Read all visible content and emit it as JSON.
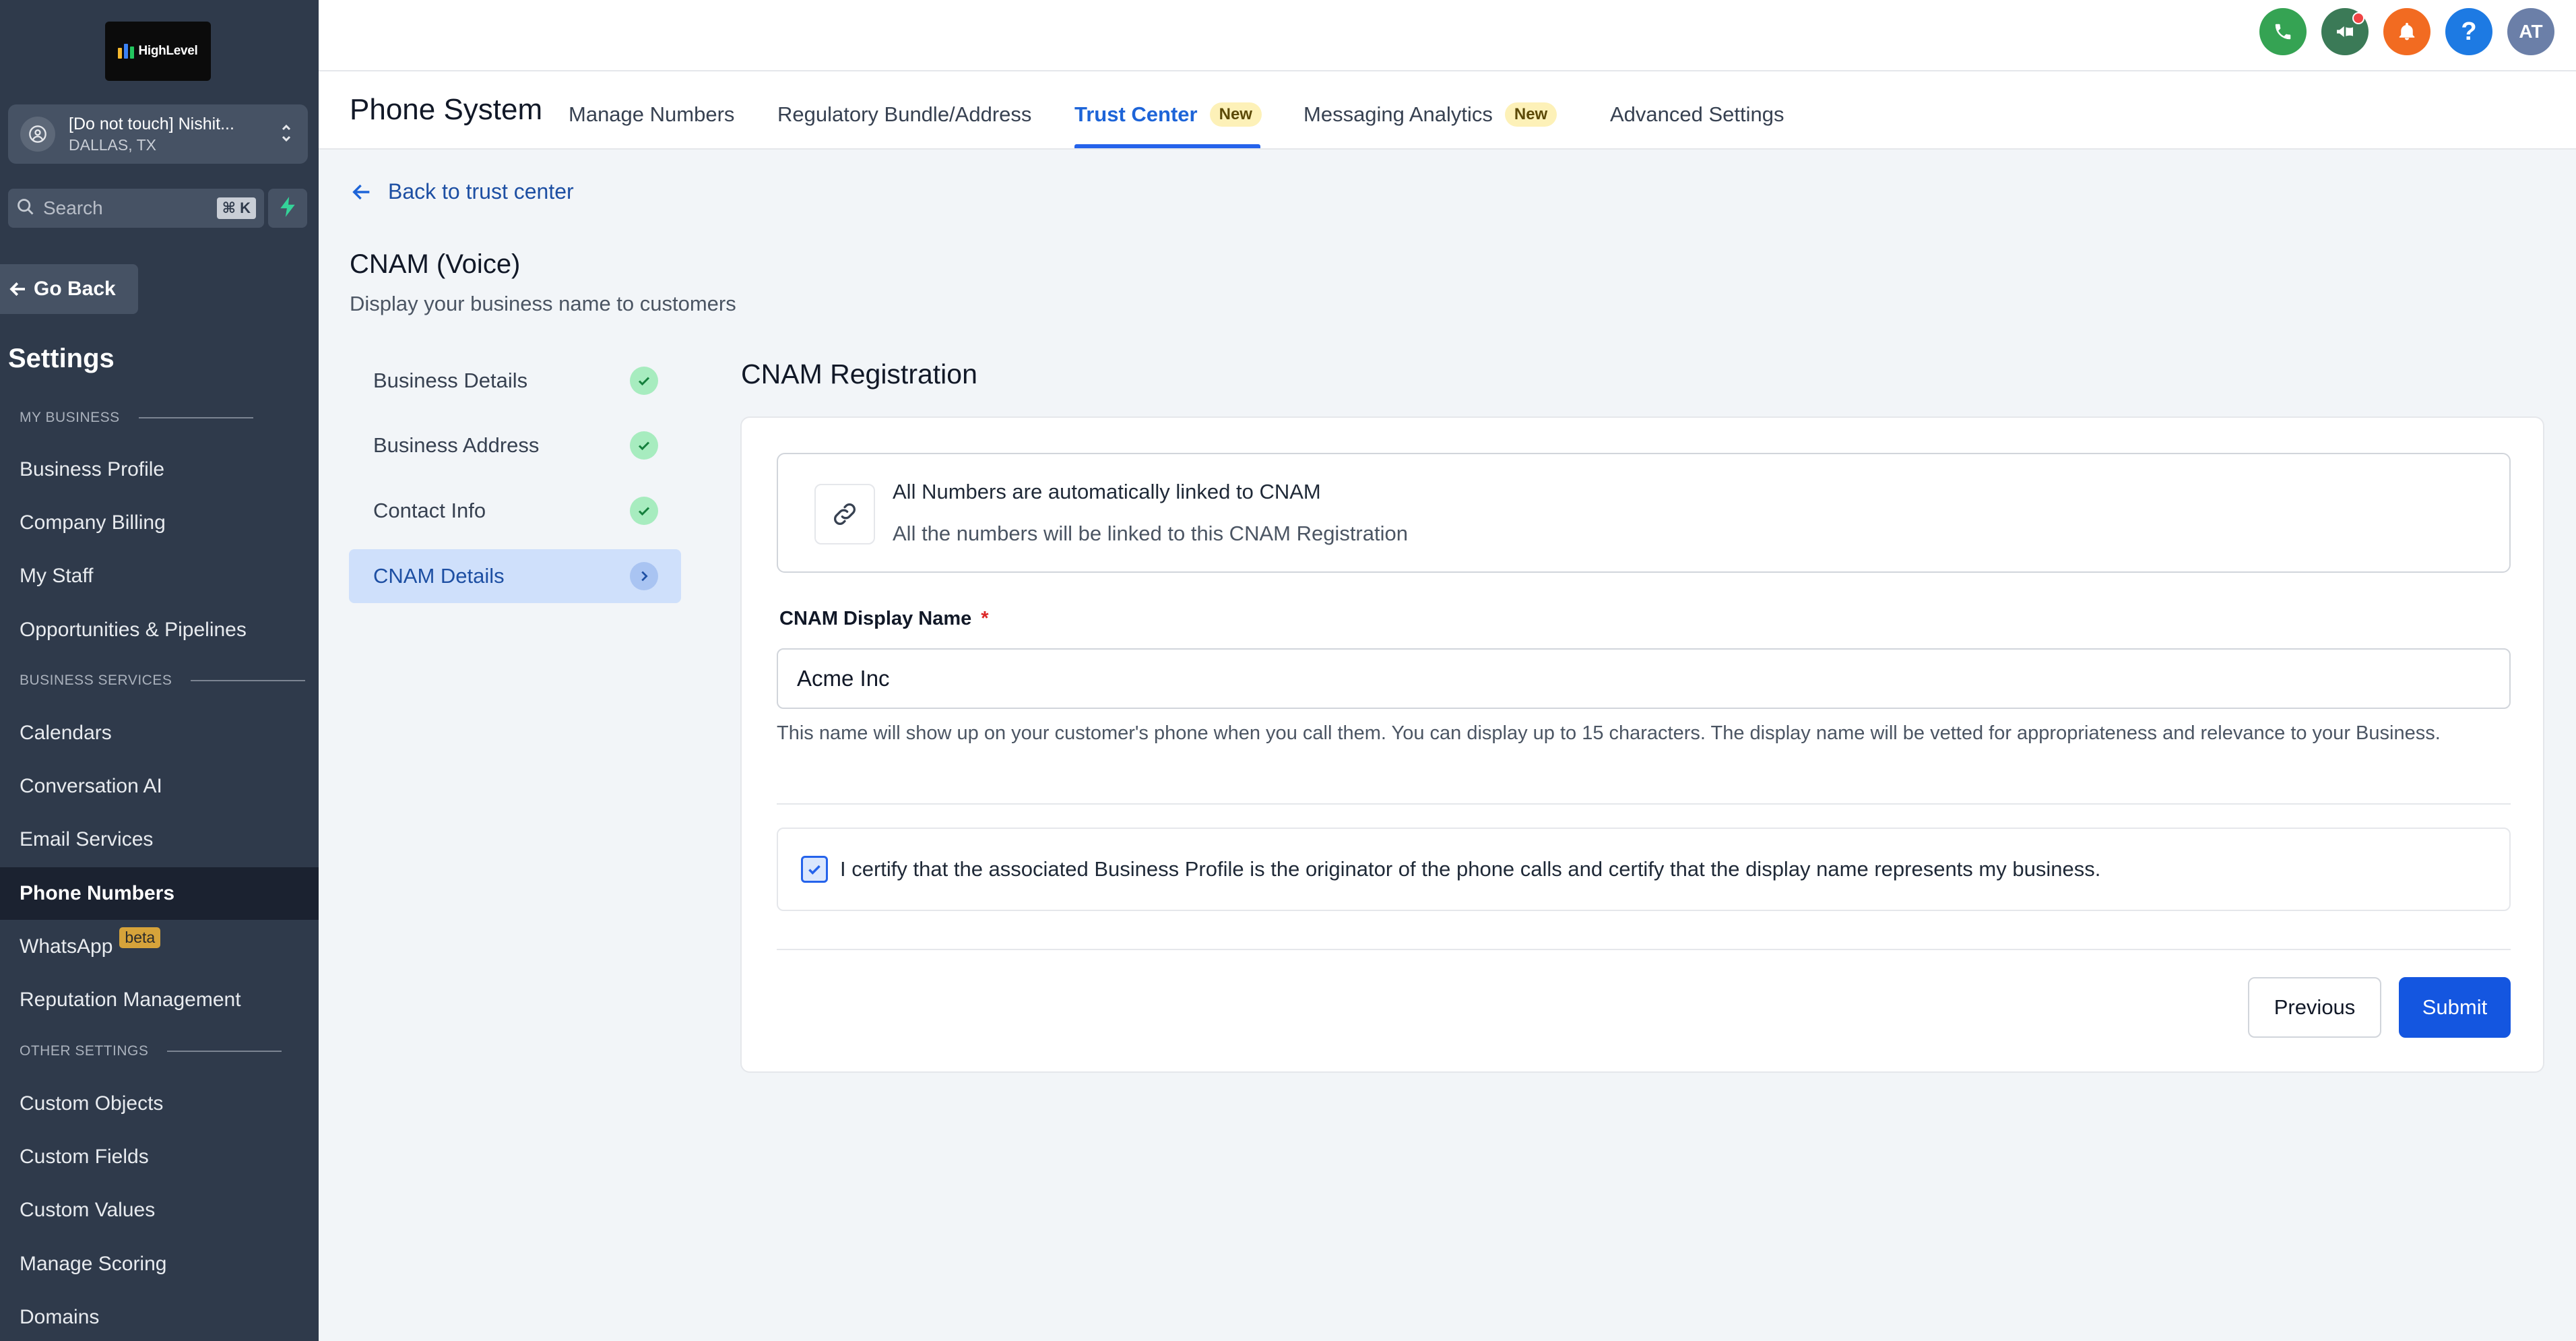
{
  "brand": {
    "logo_text": "HighLevel"
  },
  "account": {
    "name": "[Do not touch] Nishit...",
    "location": "DALLAS, TX"
  },
  "search": {
    "placeholder": "Search",
    "shortcut": "⌘ K"
  },
  "sidebar": {
    "go_back": "Go Back",
    "title": "Settings",
    "sections": [
      {
        "label": "MY BUSINESS"
      },
      {
        "label": "BUSINESS SERVICES"
      },
      {
        "label": "OTHER SETTINGS"
      }
    ],
    "items": [
      {
        "label": "Business Profile"
      },
      {
        "label": "Company Billing"
      },
      {
        "label": "My Staff"
      },
      {
        "label": "Opportunities & Pipelines"
      },
      {
        "label": "Calendars"
      },
      {
        "label": "Conversation AI"
      },
      {
        "label": "Email Services"
      },
      {
        "label": "Phone Numbers"
      },
      {
        "label": "WhatsApp",
        "badge": "beta"
      },
      {
        "label": "Reputation Management"
      },
      {
        "label": "Custom Objects"
      },
      {
        "label": "Custom Fields"
      },
      {
        "label": "Custom Values"
      },
      {
        "label": "Manage Scoring"
      },
      {
        "label": "Domains"
      }
    ]
  },
  "header": {
    "user_initials": "AT",
    "icons": [
      "phone-icon",
      "megaphone-icon",
      "bell-icon",
      "help-icon"
    ],
    "colors": {
      "phone": "#35a353",
      "megaphone": "#3b7a57",
      "bell": "#f26b21",
      "help": "#1d7ae3",
      "avatar": "#6b7fa8"
    }
  },
  "tabs": {
    "title": "Phone System",
    "items": [
      {
        "label": "Manage Numbers"
      },
      {
        "label": "Regulatory Bundle/Address"
      },
      {
        "label": "Trust Center",
        "badge": "New"
      },
      {
        "label": "Messaging Analytics",
        "badge": "New"
      },
      {
        "label": "Advanced Settings"
      }
    ],
    "active": "Trust Center"
  },
  "content": {
    "back_link": "Back to trust center",
    "title": "CNAM (Voice)",
    "subtitle": "Display your business name to customers",
    "steps": [
      {
        "label": "Business Details",
        "status": "complete"
      },
      {
        "label": "Business Address",
        "status": "complete"
      },
      {
        "label": "Contact Info",
        "status": "complete"
      },
      {
        "label": "CNAM Details",
        "status": "current"
      }
    ],
    "section_title": "CNAM Registration",
    "info": {
      "title": "All Numbers are automatically linked to CNAM",
      "subtitle": "All the numbers will be linked to this CNAM Registration"
    },
    "field": {
      "label": "CNAM Display Name",
      "required_mark": "*",
      "value": "Acme Inc",
      "help": "This name will show up on your customer's phone when you call them. You can display up to 15 characters. The display name will be vetted for appropriateness and relevance to your Business."
    },
    "certify": {
      "checked": true,
      "text": "I certify that the associated Business Profile is the originator of the phone calls and certify that the display name represents my business."
    },
    "buttons": {
      "previous": "Previous",
      "submit": "Submit"
    }
  },
  "theme": {
    "accent": "#1456e0",
    "sidebar_bg": "#2f3a4b",
    "success": "#a7ecbf"
  }
}
